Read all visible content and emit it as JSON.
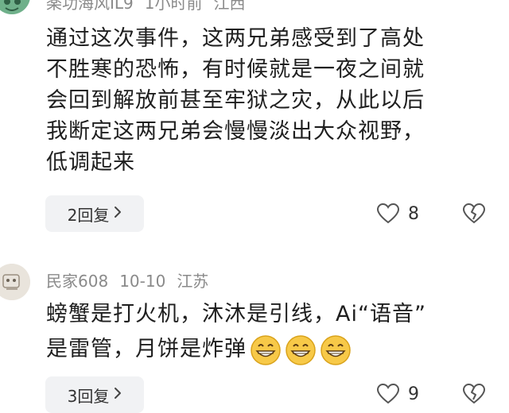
{
  "comments": [
    {
      "author": "楽功海风IL9",
      "time": "1小时前",
      "location": "江西",
      "lines": [
        "通过这次事件，这两兄弟感受到了高处",
        "不胜寒的恐怖，有时候就是一夜之间就",
        "会回到解放前甚至牢狱之灾，从此以后",
        "我断定这两兄弟会慢慢淡出大众视野，",
        "低调起来"
      ],
      "reply_label": "2回复",
      "likes": "8"
    },
    {
      "author": "民家608",
      "time": "10-10",
      "location": "江苏",
      "lines": [
        "螃蟹是打火机，沐沐是引线，Ai“语音”",
        "是雷管，月饼是炸弹"
      ],
      "reply_label": "3回复",
      "likes": "9"
    }
  ],
  "colors": {
    "meta": "#8a8a8a",
    "pill": "#f1f2f4",
    "icon": "#555555",
    "avatar1": "#6fb08a",
    "avatar2": "#e9e4dc"
  },
  "icons": {
    "like": "heart-outline-icon",
    "dislike": "broken-heart-icon",
    "chevron": "chevron-right-icon",
    "emoji": "grinning-face-emoji"
  }
}
